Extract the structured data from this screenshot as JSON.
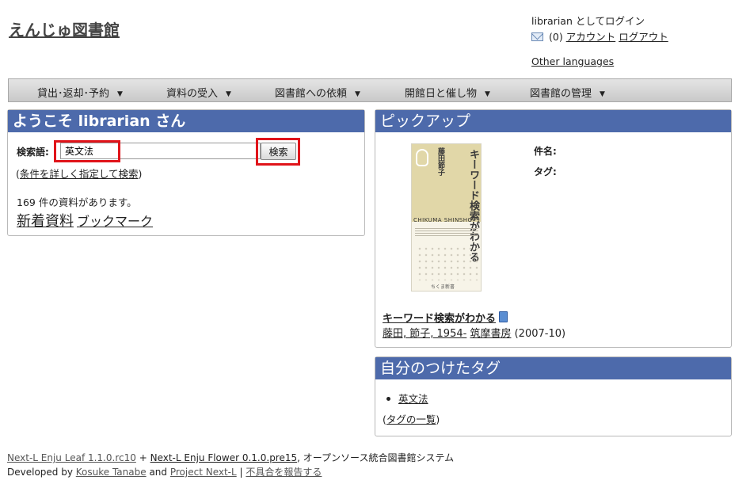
{
  "header": {
    "site_title": "えんじゅ図書館",
    "login_status": "librarian としてログイン",
    "message_count": "(0)",
    "account_link": "アカウント",
    "logout_link": "ログアウト",
    "other_languages": "Other languages"
  },
  "menu": {
    "items": [
      {
        "label": "貸出･返却･予約"
      },
      {
        "label": "資料の受入"
      },
      {
        "label": "図書館への依頼"
      },
      {
        "label": "開館日と催し物"
      },
      {
        "label": "図書館の管理"
      }
    ],
    "caret": "▼"
  },
  "welcome": {
    "title": "ようこそ librarian さん",
    "search_label": "検索語:",
    "search_value": "英文法",
    "search_button": "検索",
    "advanced_search_pre": "(",
    "advanced_search_link": "条件を詳しく指定して検索",
    "advanced_search_post": ")",
    "count_text": "169 件の資料があります。",
    "new_items_link": "新着資料",
    "bookmark_link": "ブックマーク"
  },
  "pickup": {
    "title": "ピックアップ",
    "subject_label": "件名:",
    "tag_label": "タグ:",
    "book_title": "キーワード検索がわかる",
    "author": "藤田, 節子, 1954-",
    "publisher": "筑摩書房",
    "date": "(2007-10)",
    "cover": {
      "title": "キーワード検索がわかる",
      "author": "藤田節子",
      "series": "CHIKUMA SHINSHO",
      "publisher": "ちくま新書"
    }
  },
  "tags": {
    "title": "自分のつけたタグ",
    "items": [
      "英文法"
    ],
    "index_pre": "(",
    "index_link": "タグの一覧",
    "index_post": ")"
  },
  "footer": {
    "leaf_link": "Next-L Enju Leaf 1.1.0.rc10",
    "plus": "+",
    "flower_link": "Next-L Enju Flower 0.1.0.pre15",
    "description": ", オープンソース統合図書館システム",
    "developed_by": "Developed by",
    "author_link": "Kosuke Tanabe",
    "and": "and",
    "project_link": "Project Next-L",
    "separator": "|",
    "report_link": "不具合を報告する"
  },
  "colors": {
    "panel_header": "#4d6aab",
    "highlight": "#e0141a"
  }
}
